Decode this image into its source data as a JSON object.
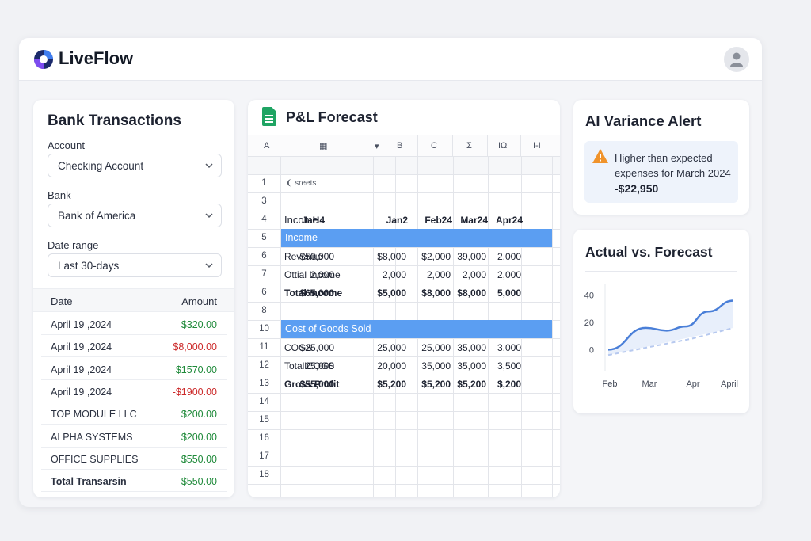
{
  "app": {
    "brand": "LiveFlow"
  },
  "bank": {
    "title": "Bank Transactions",
    "account_label": "Account",
    "account_value": "Checking Account",
    "bank_label": "Bank",
    "bank_value": "Bank of America",
    "range_label": "Date range",
    "range_value": "Last 30-days",
    "col_date": "Date",
    "col_amount": "Amount",
    "rows": [
      {
        "date": "April 19 ,2024",
        "amount": "$320.00",
        "kind": "pos"
      },
      {
        "date": "April 19 ,2024",
        "amount": "$8,000.00",
        "kind": "neg"
      },
      {
        "date": "April 19 ,2024",
        "amount": "$1570.00",
        "kind": "pos"
      },
      {
        "date": "April 19 ,2024",
        "amount": "-$1900.00",
        "kind": "neg"
      },
      {
        "date": "TOP MODULE LLC",
        "amount": "$200.00",
        "kind": "pos"
      },
      {
        "date": "ALPHA SYSTEMS",
        "amount": "$200.00",
        "kind": "pos"
      },
      {
        "date": "OFFICE SUPPLIES",
        "amount": "$550.00",
        "kind": "pos"
      },
      {
        "date": "Total Transarsin",
        "amount": "$550.00",
        "kind": "pos",
        "bold": true
      }
    ]
  },
  "sheet": {
    "title": "P&L Forecast",
    "toolbar": [
      "A",
      "▦",
      "▾",
      "B",
      "C",
      "Σ",
      "IΩ",
      "I-I"
    ],
    "row_numbers": [
      "1",
      "3",
      "4",
      "5",
      "6",
      "7",
      "6",
      "8",
      "10",
      "11",
      "12",
      "13",
      "14",
      "15",
      "16",
      "17",
      "18"
    ],
    "row1_text": "sreets",
    "header": {
      "label": "Income",
      "cols": [
        "JaH4",
        "Jan2",
        "Feb24",
        "Mar24",
        "Apr24"
      ]
    },
    "band_income": "Income",
    "band_cogs": "Cost of Goods Sold",
    "rows": [
      {
        "label": "Revenue",
        "vals": [
          "$50,000",
          "$8,000",
          "$2,000",
          "39,000",
          "2,000"
        ],
        "bold": false
      },
      {
        "label": "Ottial Income",
        "vals": [
          "2,000",
          "2,000",
          "2,000",
          "2,000",
          "2,000"
        ],
        "bold": false
      },
      {
        "label": "Total Income",
        "vals": [
          "$65,000",
          "$5,000",
          "$8,000",
          "$8,000",
          "5,000"
        ],
        "bold": true
      },
      {
        "label": "COGS",
        "vals": [
          "$25,000",
          "25,000",
          "25,000",
          "35,000",
          "3,000"
        ],
        "bold": false
      },
      {
        "label": "TotallCOGS",
        "vals": [
          "25,000",
          "20,000",
          "35,000",
          "35,000",
          "3,500"
        ],
        "bold": false
      },
      {
        "label": "Gross Profit",
        "vals": [
          "$55,000",
          "$5,200",
          "$5,200",
          "$5,200",
          "$,200"
        ],
        "bold": true
      }
    ]
  },
  "alert": {
    "title": "AI Variance Alert",
    "text": "Higher than expected expenses for March 2024",
    "amount": "-$22,950",
    "icon": "warning-icon",
    "color": "#f0932b"
  },
  "chart_data": {
    "type": "line",
    "title": "Actual vs. Forecast",
    "categories": [
      "Feb",
      "Mar",
      "Apr",
      "April"
    ],
    "ylim": [
      -5,
      45
    ],
    "yticks": [
      "40",
      "20",
      "0"
    ],
    "grid": false,
    "legend": "none",
    "series": [
      {
        "values": [
          0,
          15,
          28,
          36
        ],
        "color": "#4a7fd8",
        "style": "solid",
        "x": [
          0,
          1,
          2,
          3
        ],
        "points": [
          [
            0,
            0
          ],
          [
            0.9,
            16
          ],
          [
            1.4,
            14
          ],
          [
            1.85,
            17
          ],
          [
            2.4,
            28
          ],
          [
            3.0,
            36
          ]
        ]
      },
      {
        "values": [
          -4,
          3,
          9,
          16
        ],
        "color": "#b7c9ef",
        "style": "dashed",
        "points": [
          [
            0,
            -4
          ],
          [
            1,
            2
          ],
          [
            2,
            8
          ],
          [
            3,
            16
          ]
        ]
      }
    ]
  }
}
